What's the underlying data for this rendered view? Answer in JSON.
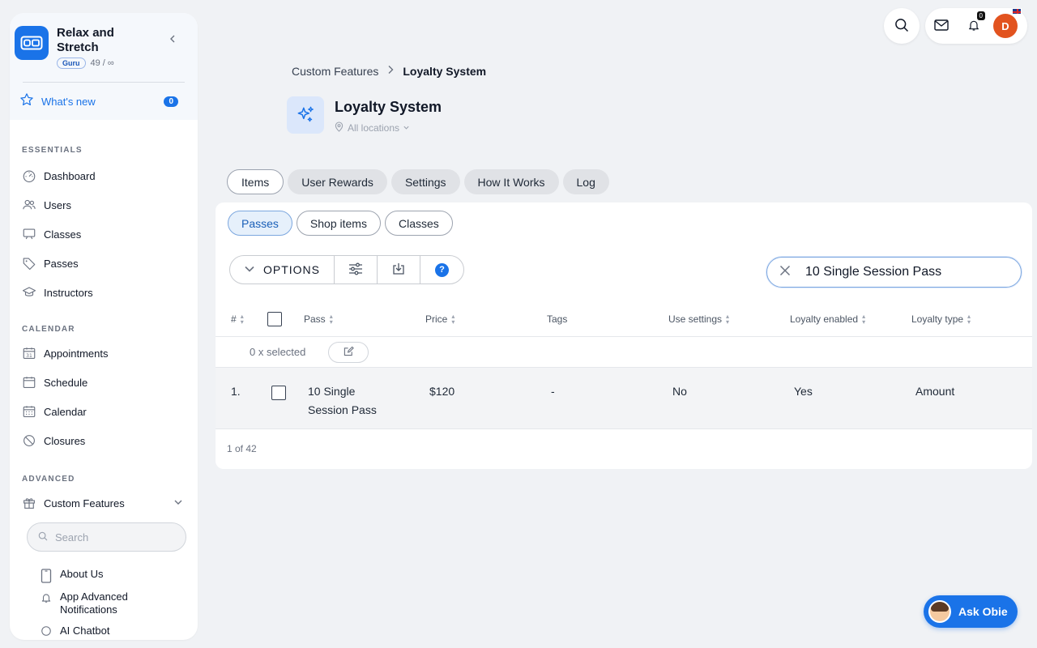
{
  "brand": {
    "name": "Relax and Stretch",
    "badge": "Guru",
    "usage": "49 / ∞"
  },
  "whats_new": {
    "label": "What's new",
    "count": "0"
  },
  "sections": {
    "essentials": "ESSENTIALS",
    "calendar": "CALENDAR",
    "advanced": "ADVANCED"
  },
  "nav": {
    "dashboard": "Dashboard",
    "users": "Users",
    "classes": "Classes",
    "passes": "Passes",
    "instructors": "Instructors",
    "appointments": "Appointments",
    "schedule": "Schedule",
    "calendar": "Calendar",
    "closures": "Closures",
    "custom_features": "Custom Features"
  },
  "sidebar_search": {
    "placeholder": "Search"
  },
  "sub_nav": {
    "about_us": "About Us",
    "app_notifications": "App Advanced Notifications",
    "ai_chatbot": "AI Chatbot"
  },
  "top": {
    "notif_count": "0",
    "avatar_initial": "D"
  },
  "breadcrumb": {
    "parent": "Custom Features",
    "current": "Loyalty System"
  },
  "page": {
    "title": "Loyalty System",
    "location": "All locations"
  },
  "tabs": [
    "Items",
    "User Rewards",
    "Settings",
    "How It Works",
    "Log"
  ],
  "subtabs": [
    "Passes",
    "Shop items",
    "Classes"
  ],
  "toolbar": {
    "options_label": "OPTIONS",
    "help": "?"
  },
  "table_search": {
    "value": "10 Single Session Pass"
  },
  "columns": {
    "num": "#",
    "pass": "Pass",
    "price": "Price",
    "tags": "Tags",
    "use_settings": "Use settings",
    "loyalty_enabled": "Loyalty enabled",
    "loyalty_type": "Loyalty type"
  },
  "selection": {
    "text": "0 x selected"
  },
  "rows": [
    {
      "num": "1.",
      "pass": "10 Single Session Pass",
      "price": "$120",
      "tags": "-",
      "use_settings": "No",
      "loyalty_enabled": "Yes",
      "loyalty_type": "Amount"
    }
  ],
  "pager": {
    "text": "1 of 42"
  },
  "ask": {
    "label": "Ask Obie"
  },
  "colors": {
    "accent": "#1a73e8",
    "avatar": "#e2531f",
    "bg": "#f0f2f5"
  }
}
